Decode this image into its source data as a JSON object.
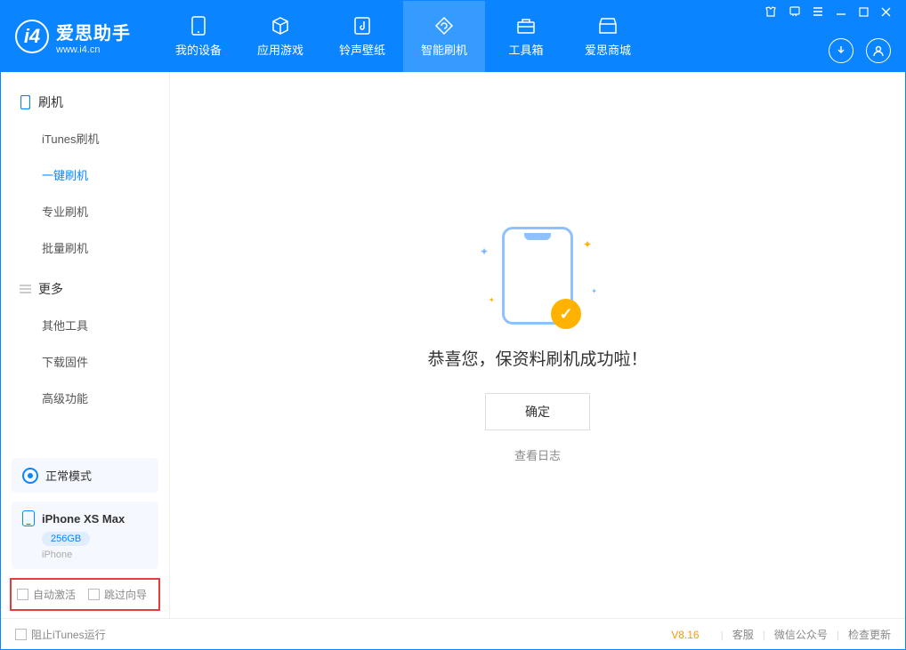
{
  "app": {
    "title": "爱思助手",
    "url": "www.i4.cn"
  },
  "tabs": [
    {
      "label": "我的设备",
      "icon": "device"
    },
    {
      "label": "应用游戏",
      "icon": "cube"
    },
    {
      "label": "铃声壁纸",
      "icon": "music"
    },
    {
      "label": "智能刷机",
      "icon": "refresh",
      "active": true
    },
    {
      "label": "工具箱",
      "icon": "toolbox"
    },
    {
      "label": "爱思商城",
      "icon": "store"
    }
  ],
  "sidebar": {
    "section1": {
      "title": "刷机",
      "items": [
        "iTunes刷机",
        "一键刷机",
        "专业刷机",
        "批量刷机"
      ],
      "active": 1
    },
    "section2": {
      "title": "更多",
      "items": [
        "其他工具",
        "下载固件",
        "高级功能"
      ]
    }
  },
  "mode": {
    "label": "正常模式"
  },
  "device": {
    "name": "iPhone XS Max",
    "capacity": "256GB",
    "type": "iPhone"
  },
  "checkboxes": {
    "auto_activate": "自动激活",
    "skip_guide": "跳过向导"
  },
  "main": {
    "success": "恭喜您，保资料刷机成功啦！",
    "ok": "确定",
    "view_log": "查看日志"
  },
  "footer": {
    "block_itunes": "阻止iTunes运行",
    "version": "V8.16",
    "links": [
      "客服",
      "微信公众号",
      "检查更新"
    ]
  }
}
